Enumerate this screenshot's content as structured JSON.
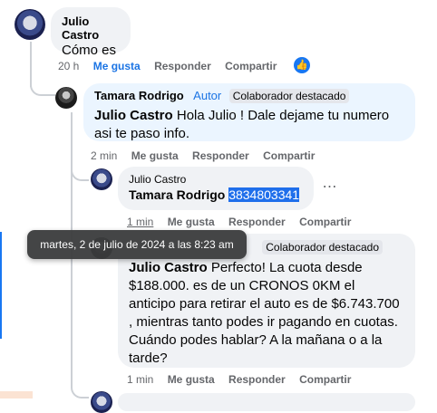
{
  "comment_1": {
    "author": "Julio Castro",
    "text": "Cómo es",
    "time": "20 h",
    "like": "Me gusta",
    "reply": "Responder",
    "share": "Compartir",
    "reaction_icon": "like-icon"
  },
  "reply_1": {
    "author": "Tamara Rodrigo",
    "author_badge": "Autor",
    "badge": "Colaborador destacado",
    "mention": "Julio Castro",
    "text": " Hola Julio ! Dale dejame tu numero asi te paso info.",
    "time": "2 min",
    "like": "Me gusta",
    "reply": "Responder",
    "share": "Compartir"
  },
  "reply_2": {
    "author": "Julio Castro",
    "mention": "Tamara Rodrigo",
    "phone": "3834803341",
    "time": "1 min",
    "like": "Me gusta",
    "reply": "Responder",
    "share": "Compartir",
    "more_icon": "more-icon"
  },
  "reply_3": {
    "author_partial": "Tamara Rodrigo",
    "badge": "Colaborador destacado",
    "mention": "Julio Castro",
    "text": " Perfecto! La cuota desde $188.000. es de un CRONOS 0KM el anticipo para retirar el auto es de $6.743.700 , mientras tanto podes ir pagando en cuotas. Cuándo podes hablar? A la mañana o a la tarde?",
    "time": "1 min",
    "like": "Me gusta",
    "reply": "Responder",
    "share": "Compartir"
  },
  "tooltip": {
    "text": "martes, 2 de julio de 2024 a las 8:23 am"
  },
  "colors": {
    "accent": "#1b74e4",
    "bubble": "#f0f2f5",
    "highlight_bubble": "#ebf5ff",
    "tooltip_bg": "#3a3b3c"
  }
}
